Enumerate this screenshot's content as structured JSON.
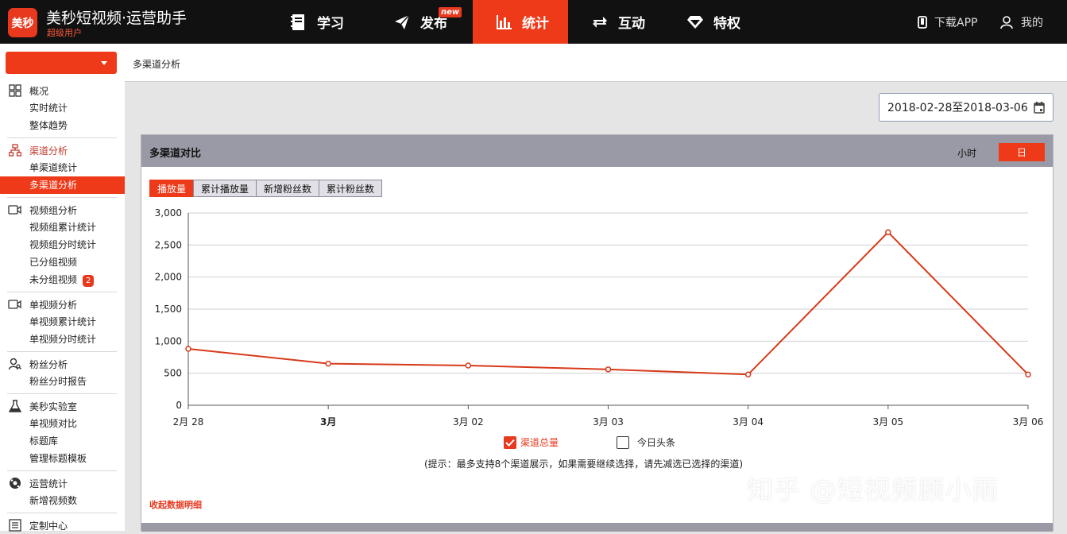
{
  "header": {
    "logo_text": "美秒",
    "app_title": "美秒短视频·运营助手",
    "user_level": "超级用户",
    "nav": [
      {
        "label": "学习",
        "icon": "book-icon"
      },
      {
        "label": "发布",
        "icon": "send-icon",
        "badge": "new"
      },
      {
        "label": "统计",
        "icon": "bar-chart-icon",
        "active": true
      },
      {
        "label": "互动",
        "icon": "swap-arrows-icon"
      },
      {
        "label": "特权",
        "icon": "diamond-icon"
      }
    ],
    "download_app": "下载APP",
    "mine": "我的"
  },
  "sidebar": {
    "sections": [
      {
        "label": "概况",
        "icon": "grid-icon",
        "items": [
          "实时统计",
          "整体趋势"
        ]
      },
      {
        "label": "渠道分析",
        "icon": "hierarchy-icon",
        "active": true,
        "items": [
          "单渠道统计",
          "多渠道分析"
        ],
        "active_item": "多渠道分析"
      },
      {
        "label": "视频组分析",
        "icon": "video-camera-icon",
        "items": [
          "视频组累计统计",
          "视频组分时统计",
          "已分组视频",
          "未分组视频"
        ],
        "badge": "2"
      },
      {
        "label": "单视频分析",
        "icon": "video-camera-icon",
        "items": [
          "单视频累计统计",
          "单视频分时统计"
        ]
      },
      {
        "label": "粉丝分析",
        "icon": "user-search-icon",
        "items": [
          "粉丝分时报告"
        ]
      },
      {
        "label": "美秒实验室",
        "icon": "flask-icon",
        "items": [
          "单视频对比",
          "标题库",
          "管理标题模板"
        ]
      },
      {
        "label": "运营统计",
        "icon": "globe-icon",
        "items": [
          "新增视频数"
        ]
      },
      {
        "label": "定制中心",
        "icon": "list-icon",
        "items": []
      }
    ]
  },
  "breadcrumb": "多渠道分析",
  "date_range": "2018-02-28至2018-03-06",
  "panel": {
    "title": "多渠道对比",
    "hour_label": "小时",
    "day_label": "日",
    "tabs": [
      "播放量",
      "累计播放量",
      "新增粉丝数",
      "累计粉丝数"
    ],
    "active_tab": "播放量",
    "legend": [
      {
        "label": "渠道总量",
        "checked": true,
        "color": "#e8391f"
      },
      {
        "label": "今日头条",
        "checked": false,
        "color": "#333333"
      }
    ],
    "tip": "(提示：最多支持8个渠道展示，如果需要继续选择，请先减选已选择的渠道)",
    "collapse_link": "收起数据明细"
  },
  "watermark": "知乎 @短视频顾小雨",
  "chart_data": {
    "type": "line",
    "categories": [
      "2月 28",
      "3月",
      "3月 02",
      "3月 03",
      "3月 04",
      "3月 05",
      "3月 06"
    ],
    "series": [
      {
        "name": "渠道总量",
        "values": [
          880,
          650,
          620,
          560,
          480,
          2700,
          480
        ],
        "color": "#d73a1a"
      }
    ],
    "y_ticks": [
      "0",
      "500",
      "1,000",
      "1,500",
      "2,000",
      "2,500",
      "3,000"
    ],
    "ylim": [
      0,
      3000
    ],
    "grid": true,
    "legend": "bottom-center"
  }
}
